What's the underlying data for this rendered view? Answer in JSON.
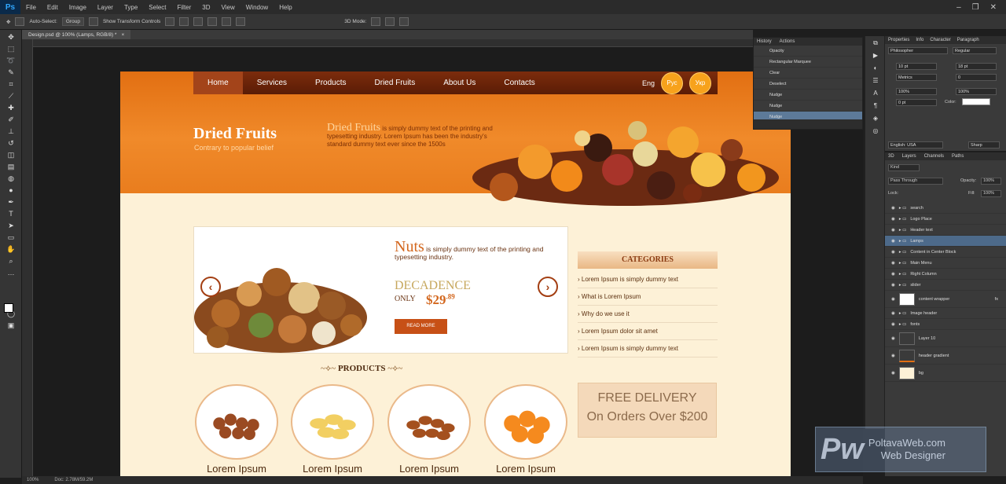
{
  "menubar": {
    "app_icon": "Ps",
    "items": [
      "File",
      "Edit",
      "Image",
      "Layer",
      "Type",
      "Select",
      "Filter",
      "3D",
      "View",
      "Window",
      "Help"
    ],
    "win_controls": [
      "–",
      "❐",
      "✕"
    ]
  },
  "options": {
    "auto_select": "Auto-Select:",
    "auto_select_value": "Group",
    "show_transform": "Show Transform Controls",
    "mode3d": "3D Mode:"
  },
  "document_tab": {
    "title": "Design.psd @ 100% (Lamps, RGB/8) *",
    "close": "×"
  },
  "status": {
    "zoom": "100%",
    "doc": "Doc: 2.78M/59.2M"
  },
  "site": {
    "nav": [
      "Home",
      "Services",
      "Products",
      "Dried Fruits",
      "About Us",
      "Contacts"
    ],
    "lang": "Eng",
    "circle1": "Рус",
    "circle2": "Укр",
    "hero_title": "Dried Fruits",
    "hero_sub": "Contrary to popular belief",
    "hero_desc_hl": "Dried Fruits",
    "hero_desc": " is simply dummy text of the printing and typesetting industry. Lorem Ipsum has been the industry's standard dummy text ever since the 1500s",
    "slider_big": "Nuts",
    "slider_text": " is simply dummy text of the printing and typesetting industry.",
    "slider_dec": "DECADENCE",
    "slider_only": "ONLY",
    "slider_price": "$29",
    "slider_cents": ".89",
    "slider_btn": "READ MORE",
    "prev": "‹",
    "next": "›",
    "categories_title": "CATEGORIES",
    "categories": [
      "Lorem Ipsum is simply dummy text",
      "What is Lorem Ipsum",
      "Why do we use it",
      "Lorem Ipsum dolor sit amet",
      "Lorem Ipsum is simply dummy text"
    ],
    "products_title": "PRODUCTS",
    "orn_left": "~⟡~",
    "orn_right": "~⟡~",
    "products": [
      "Lorem Ipsum",
      "Lorem Ipsum",
      "Lorem Ipsum",
      "Lorem Ipsum"
    ],
    "free_l1": "FREE DELIVERY",
    "free_l2": "On Orders Over $200"
  },
  "history": {
    "tabs": [
      "History",
      "Actions"
    ],
    "rows": [
      "Opacity",
      "Rectangular Marquee",
      "Clear",
      "Deselect",
      "Nudge",
      "Nudge",
      "Nudge"
    ]
  },
  "character": {
    "tabs": [
      "Properties",
      "Info",
      "Character",
      "Paragraph"
    ],
    "font": "Philosopher",
    "style": "Regular",
    "size": "10 pt",
    "leading": "18 pt",
    "kerning": "Metrics",
    "tracking": "0",
    "scale_v": "100%",
    "scale_h": "100%",
    "baseline": "0 pt",
    "color_label": "Color:",
    "lang": "English: USA",
    "aa": "Sharp"
  },
  "layers": {
    "tabs": [
      "3D",
      "Layers",
      "Channels",
      "Paths"
    ],
    "kind": "Kind",
    "blend": "Pass Through",
    "opacity_label": "Opacity:",
    "opacity": "100%",
    "lock_label": "Lock:",
    "fill_label": "Fill:",
    "fill": "100%",
    "rows": [
      {
        "name": "search",
        "type": "folder"
      },
      {
        "name": "Logo Place",
        "type": "folder"
      },
      {
        "name": "Header text",
        "type": "folder"
      },
      {
        "name": "Lamps",
        "type": "folder",
        "selected": true
      },
      {
        "name": "Content in Center Block",
        "type": "folder"
      },
      {
        "name": "Main Menu",
        "type": "folder"
      },
      {
        "name": "Right Column",
        "type": "folder"
      },
      {
        "name": "slider",
        "type": "folder"
      },
      {
        "name": "content wrapper",
        "type": "thumb",
        "fx": "fx"
      },
      {
        "name": "Image header",
        "type": "folder"
      },
      {
        "name": "fonts",
        "type": "folder"
      },
      {
        "name": "Layer 10",
        "type": "thumb"
      },
      {
        "name": "header gradient",
        "type": "thumb"
      },
      {
        "name": "bg",
        "type": "thumb"
      }
    ]
  },
  "watermark": {
    "logo": "Pw",
    "line1": "PoltavaWeb.com",
    "line2": "Web Designer"
  },
  "colors": {
    "accent_orange": "#e26f12",
    "nav_brown": "#5a1c06",
    "cream": "#fdf1d7"
  }
}
